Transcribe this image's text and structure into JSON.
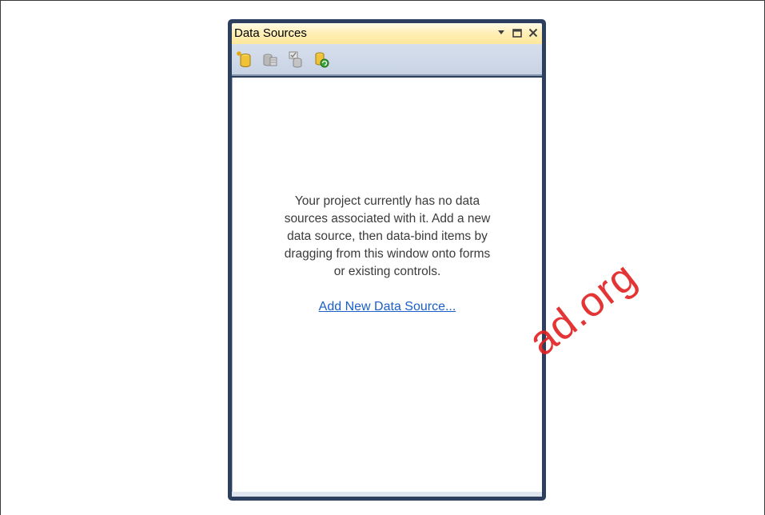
{
  "panel": {
    "title": "Data Sources",
    "title_buttons": [
      {
        "name": "window-position-dropdown",
        "icon": "chevron-down-icon"
      },
      {
        "name": "maximize-button",
        "icon": "maximize-icon"
      },
      {
        "name": "close-button",
        "icon": "close-icon"
      }
    ],
    "toolbar": [
      {
        "name": "add-new-data-source-button",
        "icon": "database-add-icon"
      },
      {
        "name": "edit-dataset-designer-button",
        "icon": "dataset-designer-icon"
      },
      {
        "name": "configure-dataset-button",
        "icon": "configure-dataset-icon"
      },
      {
        "name": "refresh-button",
        "icon": "database-refresh-icon"
      }
    ],
    "message_lines": [
      "Your project currently has no data",
      "sources associated with it. Add a new",
      "data source, then data-bind items by",
      "dragging from this window onto forms",
      "or existing controls."
    ],
    "link": "Add New Data Source..."
  },
  "watermark": {
    "text": "ad.org",
    "color": "#e02020"
  },
  "colors": {
    "panel_border": "#2d3f5e",
    "titlebar": "#fff0b9",
    "toolbar": "#cfd9e8",
    "link": "#1a5fc7"
  }
}
